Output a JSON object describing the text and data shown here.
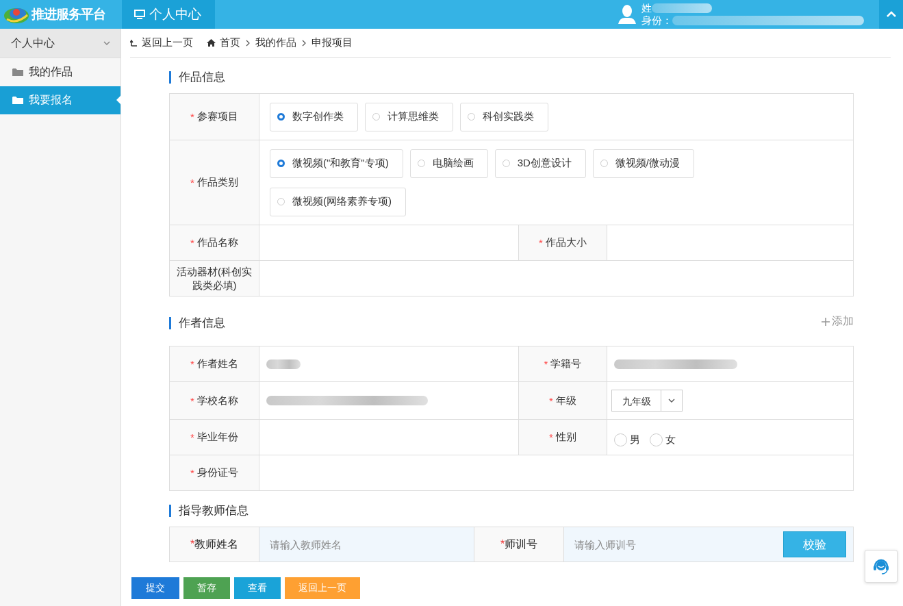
{
  "header": {
    "logo": "推进服务平台",
    "tab": "个人中心",
    "user_name": "姓",
    "user_id_label": "身份："
  },
  "sidebar": {
    "group": {
      "label": "个人中心",
      "expanded": true
    },
    "items": [
      {
        "label": "我的作品",
        "selected": false
      },
      {
        "label": "我要报名",
        "selected": true
      }
    ]
  },
  "breadcrumb": {
    "back": "返回上一页",
    "items": [
      "首页",
      "我的作品",
      "申报项目"
    ]
  },
  "work_info": {
    "title": "作品信息",
    "project": {
      "label": "参赛项目",
      "mark": "*",
      "options": [
        {
          "label": "数字创作类",
          "selected": true
        },
        {
          "label": "计算思维类",
          "selected": false
        },
        {
          "label": "科创实践类",
          "selected": false
        }
      ]
    },
    "category": {
      "label": "作品类别",
      "mark": "*",
      "options": [
        {
          "label": "微视频(\"和教育\"专项)",
          "selected": true
        },
        {
          "label": "电脑绘画",
          "selected": false
        },
        {
          "label": "3D创意设计",
          "selected": false
        },
        {
          "label": "微视频/微动漫",
          "selected": false
        },
        {
          "label": "微视频(网络素养专项)",
          "selected": false
        }
      ]
    },
    "name": {
      "label": "作品名称",
      "mark": "*"
    },
    "size": {
      "label": "作品大小",
      "mark": "*"
    },
    "equipment": {
      "label": "活动器材(科创实践类必填)"
    }
  },
  "author_info": {
    "title": "作者信息",
    "add": "添加",
    "name": {
      "label": "作者姓名",
      "mark": "*",
      "value_blurred": true
    },
    "student_no": {
      "label": "学籍号",
      "mark": "*",
      "value_blurred": true
    },
    "school": {
      "label": "学校名称",
      "mark": "*",
      "value_blurred": true
    },
    "grade": {
      "label": "年级",
      "mark": "*",
      "value": "九年级"
    },
    "graduation_year": {
      "label": "毕业年份",
      "mark": "*"
    },
    "gender": {
      "label": "性别",
      "mark": "*",
      "options": [
        {
          "label": "男",
          "selected": false
        },
        {
          "label": "女",
          "selected": false
        }
      ]
    },
    "id_number": {
      "label": "身份证号",
      "mark": "*"
    }
  },
  "teacher_info": {
    "title": "指导教师信息",
    "teacher_name": {
      "label": "教师姓名",
      "mark": "*",
      "placeholder": "请输入教师姓名"
    },
    "training_no": {
      "label": "师训号",
      "mark": "*",
      "placeholder": "请输入师训号"
    },
    "verify": "校验"
  },
  "buttons": [
    {
      "label": "提交",
      "kind": "primary"
    },
    {
      "label": "暂存",
      "kind": "success"
    },
    {
      "label": "查看",
      "kind": "info"
    },
    {
      "label": "返回上一页",
      "kind": "warning"
    }
  ]
}
